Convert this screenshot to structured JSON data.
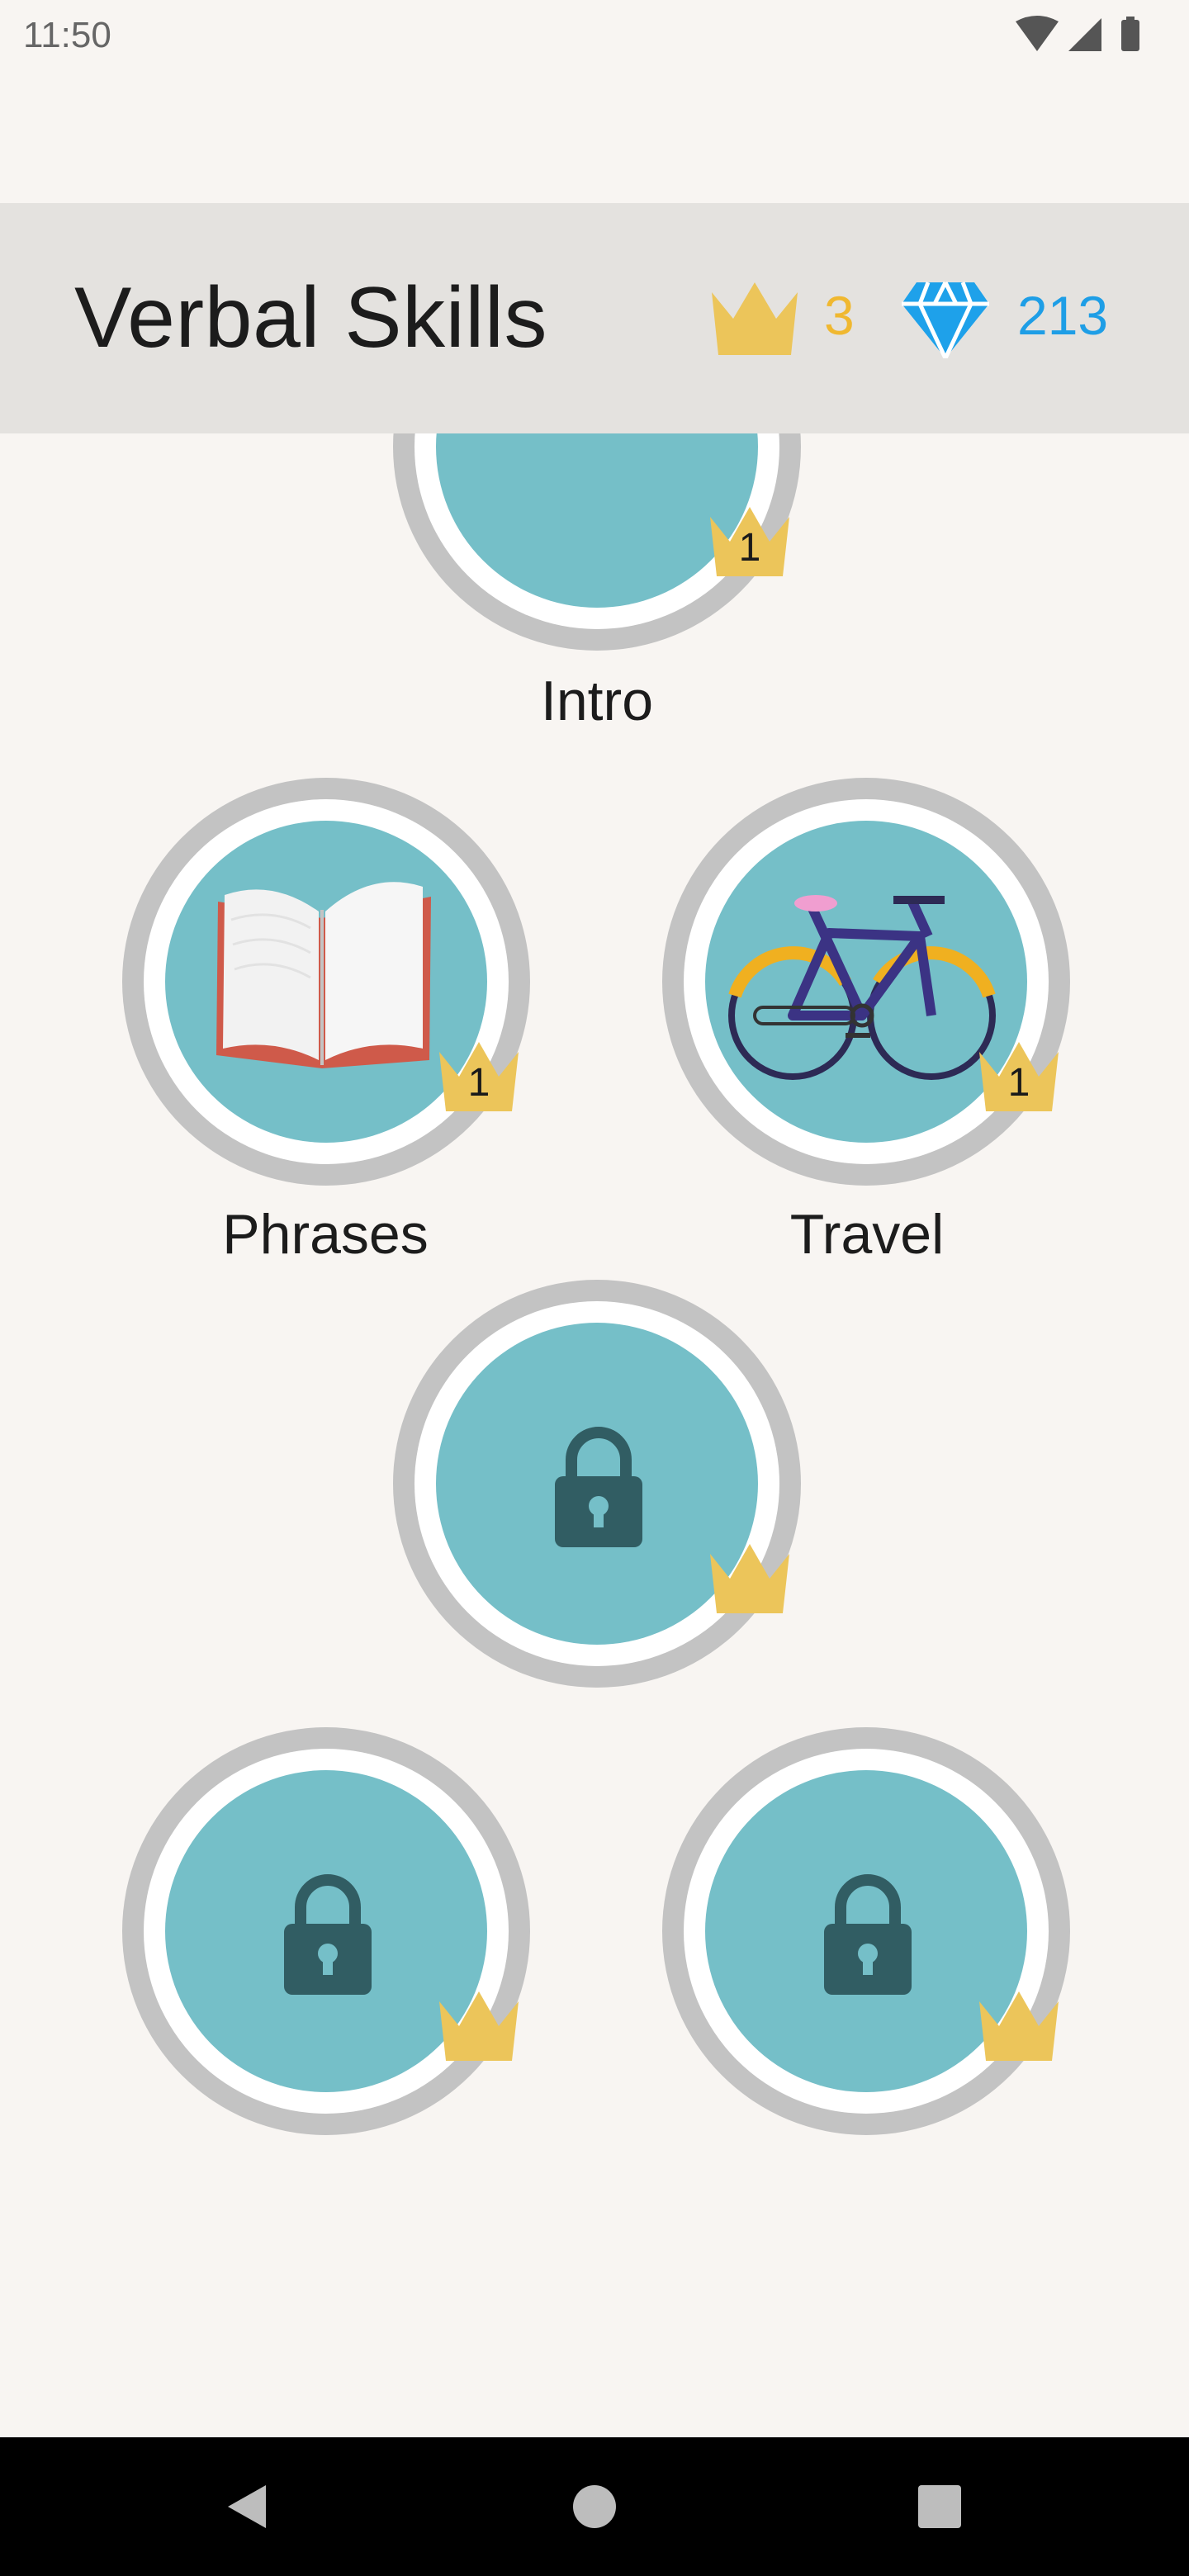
{
  "status_bar": {
    "time": "11:50"
  },
  "header": {
    "title": "Verbal Skills",
    "crowns": "3",
    "gems": "213",
    "crown_color": "#F0B830",
    "gem_color": "#1E9EE6"
  },
  "skills": [
    {
      "label": "Intro",
      "level": "1",
      "icon": "pencil-icon",
      "locked": false
    },
    {
      "label": "Phrases",
      "level": "1",
      "icon": "book-icon",
      "locked": false
    },
    {
      "label": "Travel",
      "level": "1",
      "icon": "bicycle-icon",
      "locked": false
    },
    {
      "label": "",
      "level": "",
      "icon": "lock-icon",
      "locked": true
    },
    {
      "label": "",
      "level": "",
      "icon": "lock-icon",
      "locked": true
    },
    {
      "label": "",
      "level": "",
      "icon": "lock-icon",
      "locked": true
    }
  ],
  "colors": {
    "skill_fill": "#75BFC8",
    "ring": "#C3C3C3",
    "background": "#F8F5F2",
    "header_bg": "#E4E2DF"
  }
}
